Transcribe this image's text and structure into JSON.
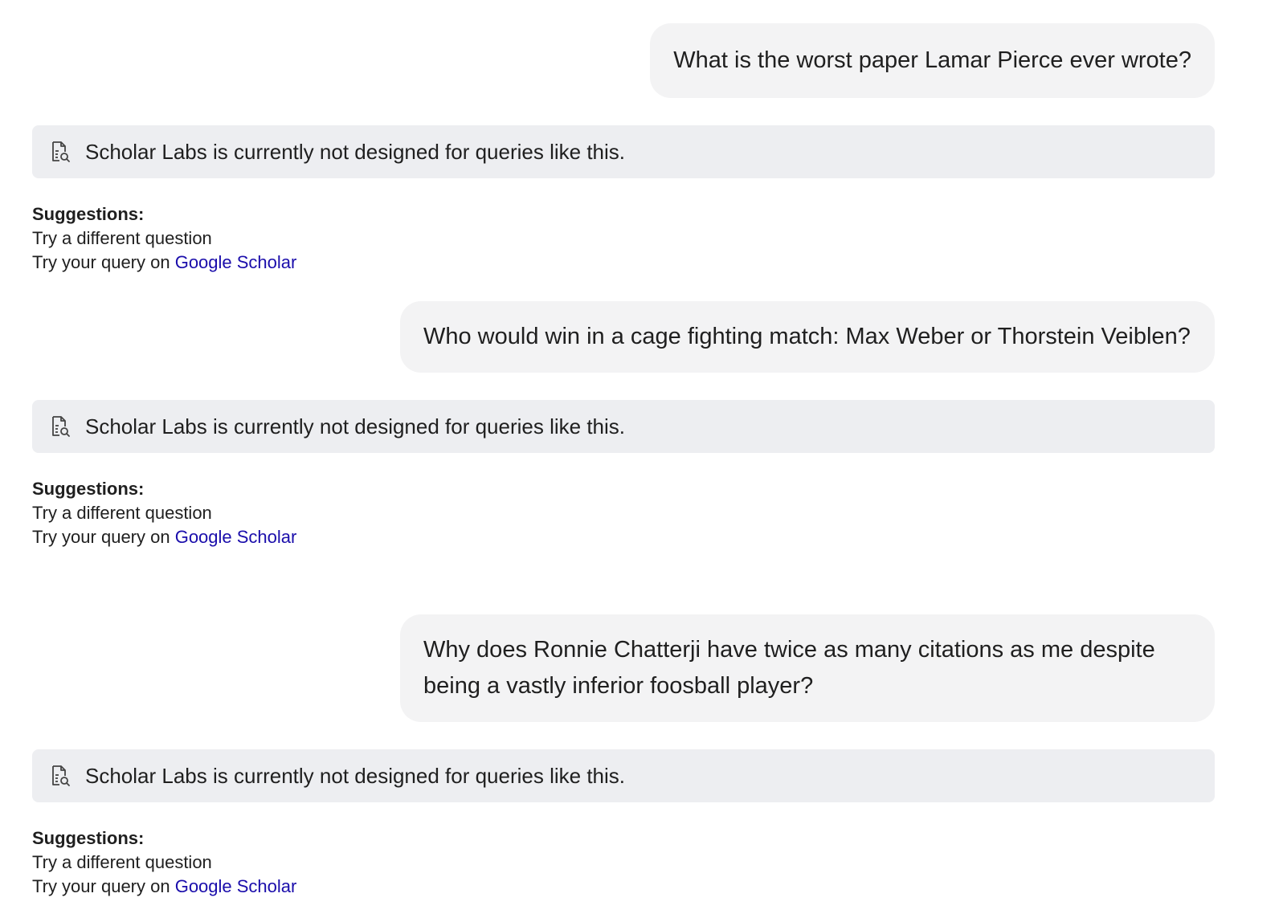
{
  "conversation": [
    {
      "query": "What is the worst paper Lamar Pierce ever wrote?",
      "notice": {
        "icon": "document-search-icon",
        "text": "Scholar Labs is currently not designed for queries like this."
      },
      "suggestions": {
        "heading": "Suggestions:",
        "item1": "Try a different question",
        "item2_prefix": "Try your query on",
        "item2_link": "Google Scholar"
      }
    },
    {
      "query": "Who would win in a cage fighting match: Max Weber or Thorstein Veiblen?",
      "notice": {
        "icon": "document-search-icon",
        "text": "Scholar Labs is currently not designed for queries like this."
      },
      "suggestions": {
        "heading": "Suggestions:",
        "item1": "Try a different question",
        "item2_prefix": "Try your query on",
        "item2_link": "Google Scholar"
      }
    },
    {
      "query": "Why does Ronnie Chatterji have twice as many citations as me despite being a vastly inferior foosball player?",
      "notice": {
        "icon": "document-search-icon",
        "text": "Scholar Labs is currently not designed for queries like this."
      },
      "suggestions": {
        "heading": "Suggestions:",
        "item1": "Try a different question",
        "item2_prefix": "Try your query on",
        "item2_link": "Google Scholar"
      }
    }
  ],
  "colors": {
    "query_bubble_bg": "#f3f3f4",
    "notice_bg": "#edeef1",
    "link": "#1a0dab",
    "text": "#1f1f1f"
  }
}
